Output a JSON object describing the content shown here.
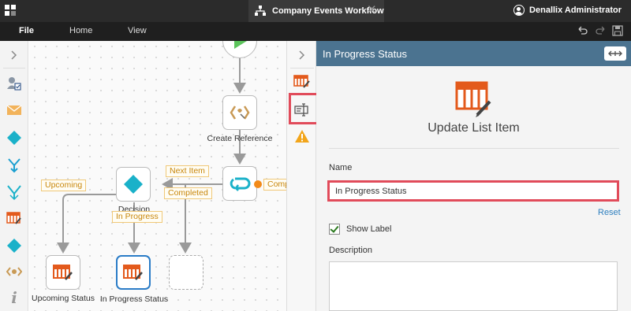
{
  "titlebar": {
    "document_title": "Company Events Workflow",
    "user_name": "Denallix Administrator"
  },
  "menu": {
    "file": "File",
    "home": "Home",
    "view": "View"
  },
  "canvas": {
    "nodes": {
      "create_reference": "Create Reference",
      "decision": "Decision",
      "upcoming_status": "Upcoming Status",
      "in_progress_status": "In Progress Status"
    },
    "chips": {
      "next_item": "Next Item",
      "completed": "Completed",
      "upcoming": "Upcoming",
      "in_progress": "In Progress",
      "comp": "Comp"
    }
  },
  "panel": {
    "header_title": "In Progress Status",
    "step_title": "Update List Item",
    "name_label": "Name",
    "name_value": "In Progress Status",
    "reset": "Reset",
    "show_label": "Show Label",
    "show_label_checked": true,
    "description_label": "Description"
  },
  "colors": {
    "accent_orange": "#e35a1c",
    "diamond_teal": "#1ab1c9",
    "panel_header": "#4b7390",
    "highlight_red": "#e14b5a",
    "start_green": "#5cc45c"
  },
  "icons": {
    "left_palette": [
      "user-task-icon",
      "email-icon",
      "decision-icon",
      "split-icon",
      "merge-icon",
      "list-item-icon",
      "diamond-icon",
      "reference-icon",
      "info-icon"
    ],
    "mid_strip": [
      "chevron-right-icon",
      "update-list-icon",
      "textbox-icon",
      "warning-icon"
    ]
  }
}
